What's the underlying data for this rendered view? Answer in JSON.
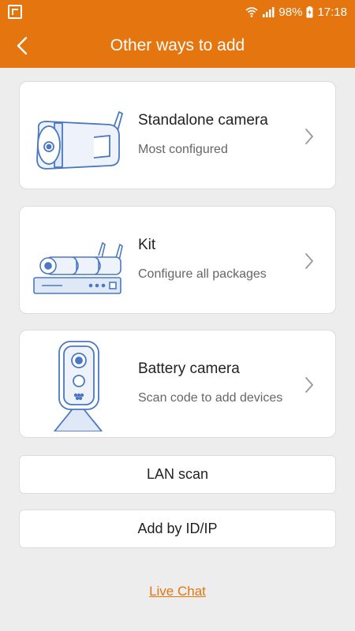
{
  "status_bar": {
    "battery": "98%",
    "time": "17:18",
    "icons": [
      "flipboard-icon",
      "wifi-icon",
      "signal-icon",
      "battery-charging-icon"
    ]
  },
  "header": {
    "title": "Other ways to add",
    "back_icon": "chevron-left-icon"
  },
  "options": [
    {
      "title": "Standalone camera",
      "subtitle": "Most configured",
      "icon": "bullet-camera-icon"
    },
    {
      "title": "Kit",
      "subtitle": "Configure all packages",
      "icon": "nvr-kit-icon"
    },
    {
      "title": "Battery camera",
      "subtitle": "Scan code to add devices",
      "icon": "battery-camera-icon"
    }
  ],
  "buttons": {
    "lan_scan": "LAN scan",
    "add_by_id": "Add by ID/IP"
  },
  "live_chat": "Live Chat",
  "colors": {
    "brand": "#e4750f",
    "background": "#ededed",
    "illustration": "#4a78c2"
  }
}
